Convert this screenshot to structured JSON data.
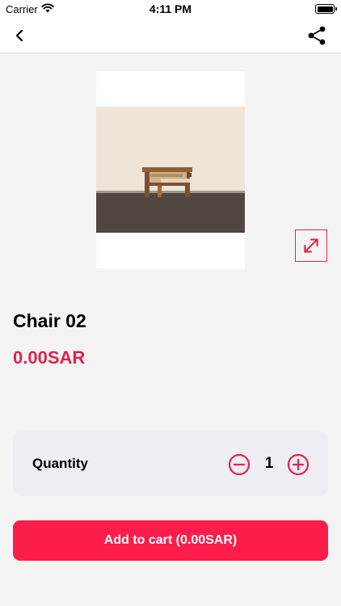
{
  "status_bar": {
    "carrier": "Carrier",
    "time": "4:11 PM"
  },
  "nav": {
    "back_icon": "chevron-left-icon",
    "share_icon": "share-icon"
  },
  "product": {
    "name": "Chair 02",
    "price": "0.00SAR",
    "expand_icon": "expand-diagonal-icon"
  },
  "quantity": {
    "label": "Quantity",
    "value": "1",
    "minus_icon": "minus-circle-icon",
    "plus_icon": "plus-circle-icon"
  },
  "cart": {
    "button_label": "Add to cart (0.00SAR)"
  },
  "colors": {
    "accent": "#e3224a",
    "button": "#fd1d4a",
    "background": "#f4f4f5",
    "card": "#eeedf3"
  }
}
